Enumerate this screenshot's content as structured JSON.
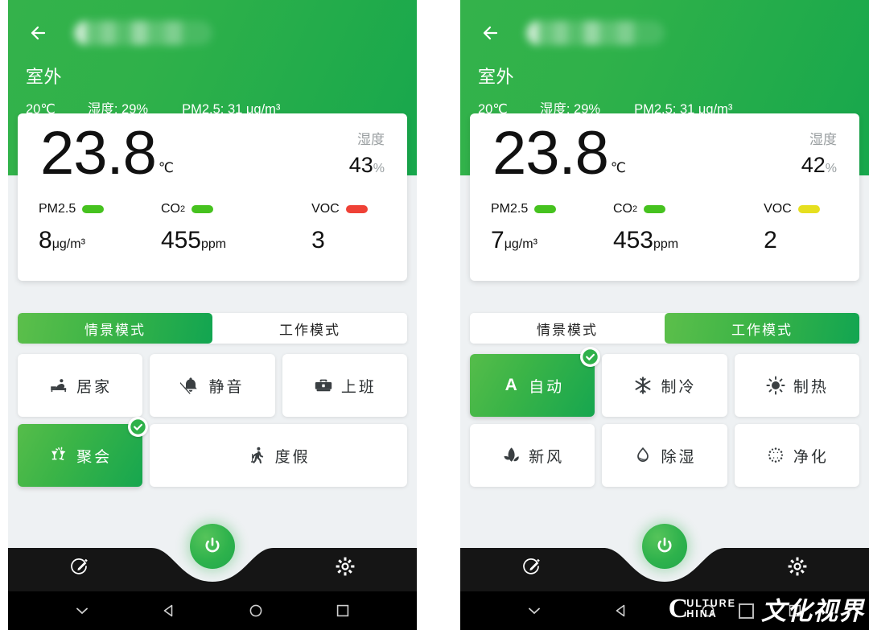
{
  "meta": {
    "brand_green": "#2fb14a",
    "accent_green": "#3bb447",
    "pill_green": "#46c21f",
    "pill_red": "#ef4136",
    "pill_yellow": "#e6df1f"
  },
  "header": {
    "back_icon": "back-arrow-icon",
    "title_redacted": "",
    "location": "室外",
    "outdoor_temp": "20℃",
    "outdoor_humidity": "湿度: 29%",
    "outdoor_pm25": "PM2.5: 31 μg/m³"
  },
  "panels": [
    {
      "id": "scene-panel",
      "card": {
        "temperature": "23.8",
        "temperature_unit": "℃",
        "humidity_label": "湿度",
        "humidity_value": "43",
        "humidity_unit": "%",
        "sensors": [
          {
            "name": "PM2.5",
            "status_color": "#46c21f",
            "value": "8",
            "unit": "μg/m³"
          },
          {
            "name": "CO",
            "sub": "2",
            "status_color": "#46c21f",
            "value": "455",
            "unit": "ppm"
          },
          {
            "name": "VOC",
            "status_color": "#ef4136",
            "value": "3",
            "unit": ""
          }
        ]
      },
      "tabs": [
        {
          "label": "情景模式",
          "active": true
        },
        {
          "label": "工作模式",
          "active": false
        }
      ],
      "modes": [
        {
          "label": "居家",
          "icon": "sofa-recline-icon",
          "active": false,
          "wide": false
        },
        {
          "label": "静音",
          "icon": "bell-off-icon",
          "active": false,
          "wide": false
        },
        {
          "label": "上班",
          "icon": "briefcase-icon",
          "active": false,
          "wide": false
        },
        {
          "label": "聚会",
          "icon": "cheers-glasses-icon",
          "active": true,
          "wide": false
        },
        {
          "label": "度假",
          "icon": "traveler-walking-icon",
          "active": false,
          "wide": true
        }
      ]
    },
    {
      "id": "work-panel",
      "card": {
        "temperature": "23.8",
        "temperature_unit": "℃",
        "humidity_label": "湿度",
        "humidity_value": "42",
        "humidity_unit": "%",
        "sensors": [
          {
            "name": "PM2.5",
            "status_color": "#46c21f",
            "value": "7",
            "unit": "μg/m³"
          },
          {
            "name": "CO",
            "sub": "2",
            "status_color": "#46c21f",
            "value": "453",
            "unit": "ppm"
          },
          {
            "name": "VOC",
            "status_color": "#e6df1f",
            "value": "2",
            "unit": ""
          }
        ]
      },
      "tabs": [
        {
          "label": "情景模式",
          "active": false
        },
        {
          "label": "工作模式",
          "active": true
        }
      ],
      "modes": [
        {
          "label": "自动",
          "icon": "letter-a-auto-icon",
          "active": true,
          "wide": false
        },
        {
          "label": "制冷",
          "icon": "snowflake-icon",
          "active": false,
          "wide": false
        },
        {
          "label": "制热",
          "icon": "sun-icon",
          "active": false,
          "wide": false
        },
        {
          "label": "新风",
          "icon": "leaf-fresh-air-icon",
          "active": false,
          "wide": false
        },
        {
          "label": "除湿",
          "icon": "water-drop-icon",
          "active": false,
          "wide": false
        },
        {
          "label": "净化",
          "icon": "purify-dots-icon",
          "active": false,
          "wide": false
        }
      ]
    }
  ],
  "bottom_bar": {
    "edit_icon": "edit-pencil-circle-icon",
    "power_icon": "power-button-icon",
    "settings_icon": "gear-icon"
  },
  "system_nav": {
    "items": [
      {
        "icon": "chevron-down-icon"
      },
      {
        "icon": "back-triangle-icon"
      },
      {
        "icon": "home-circle-icon"
      },
      {
        "icon": "recents-square-icon"
      }
    ]
  },
  "watermark": {
    "c": "C",
    "line1": "ULTURE",
    "line2": "HINA",
    "chinese": "文化视界"
  }
}
